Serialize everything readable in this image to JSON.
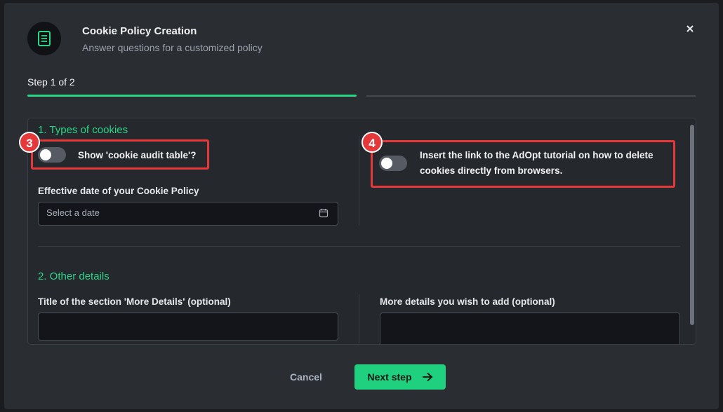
{
  "dialog": {
    "title": "Cookie Policy Creation",
    "subtitle": "Answer questions for a customized policy",
    "close_icon": "close-icon",
    "header_icon": "document-icon"
  },
  "stepper": {
    "label": "Step 1 of 2",
    "current": 1,
    "total": 2
  },
  "section1": {
    "title": "1. Types of cookies",
    "toggle_audit": {
      "label": "Show 'cookie audit table'?",
      "on": false
    },
    "toggle_tutorial": {
      "label_line1": "Insert the link to the AdOpt tutorial on how to delete",
      "label_line2": "cookies directly from browsers.",
      "on": false
    },
    "date": {
      "label": "Effective date of your Cookie Policy",
      "placeholder": "Select a date",
      "icon": "calendar-icon"
    }
  },
  "section2": {
    "title": "2. Other details",
    "more_title": {
      "label": "Title of the section 'More Details' (optional)",
      "value": ""
    },
    "more_details": {
      "label": "More details you wish to add (optional)",
      "value": ""
    }
  },
  "annotations": {
    "badge3": "3",
    "badge4": "4",
    "color": "#e5383b"
  },
  "footer": {
    "cancel_label": "Cancel",
    "next_label": "Next step",
    "next_icon": "arrow-right-icon"
  },
  "colors": {
    "accent": "#2bd687",
    "button": "#1fd07e",
    "background": "#2a2d32"
  }
}
